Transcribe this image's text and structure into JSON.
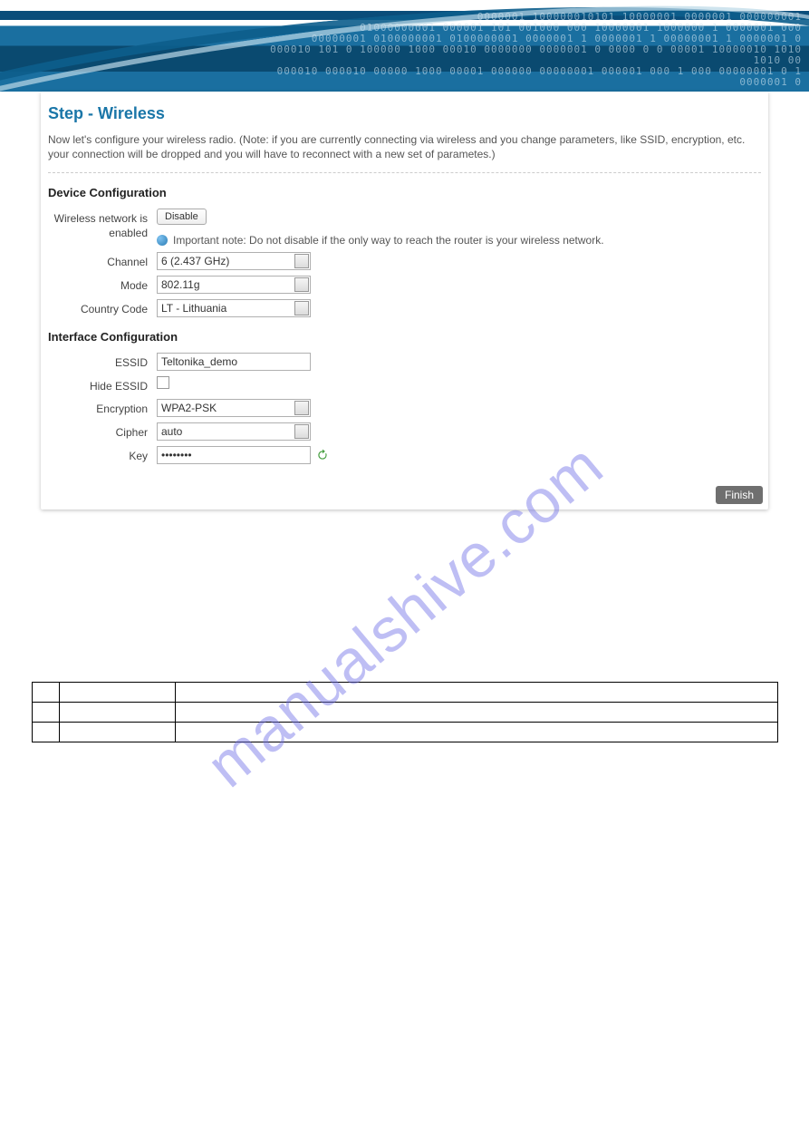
{
  "banner": {
    "binary_lines": "0000001 100000010101 10000001 0000001 000000001\n01000000001 000001 101 001000 000 10000001 1000000 1 0000001 000\n00000001 0100000001 0100000001 0000001 1 0000001 1 00000001 1 0000001 0\n000010 101 0 100000 1000 00010 0000000 0000001 0 0000 0 0 00001 10000010 1010 1010 00\n000010 000010 00000 1000 00001 000000 00000001 000001 000 1 000 00000001 0 1 0000001 0"
  },
  "page_title": "Step - Wireless",
  "intro": "Now let's configure your wireless radio. (Note: if you are currently connecting via wireless and you change parameters, like SSID, encryption, etc. your connection will be dropped and you will have to reconnect with a new set of parametes.)",
  "device_config": {
    "header": "Device Configuration",
    "wnet_label": "Wireless network is enabled",
    "disable_label": "Disable",
    "note": "Important note: Do not disable if the only way to reach the router is your wireless network.",
    "channel_label": "Channel",
    "channel_value": "6 (2.437 GHz)",
    "mode_label": "Mode",
    "mode_value": "802.11g",
    "country_label": "Country Code",
    "country_value": "LT - Lithuania"
  },
  "iface_config": {
    "header": "Interface Configuration",
    "essid_label": "ESSID",
    "essid_value": "Teltonika_demo",
    "hide_label": "Hide ESSID",
    "hide_checked": false,
    "encryption_label": "Encryption",
    "encryption_value": "WPA2-PSK",
    "cipher_label": "Cipher",
    "cipher_value": "auto",
    "key_label": "Key",
    "key_value": "••••••••"
  },
  "finish_label": "Finish",
  "watermark": "manualshive.com"
}
